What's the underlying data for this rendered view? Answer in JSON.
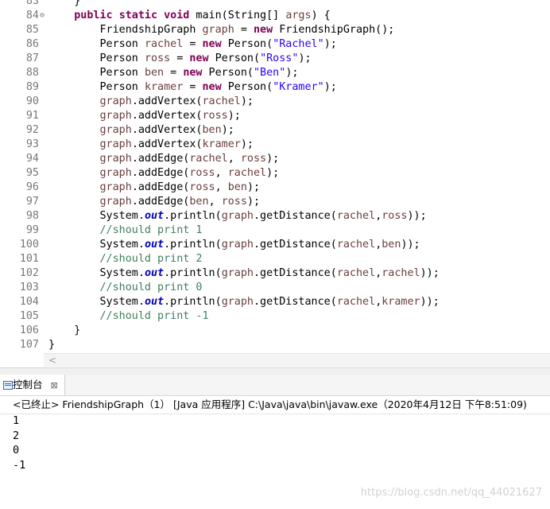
{
  "editor": {
    "lines": [
      {
        "n": "83",
        "fold": "",
        "segs": [
          {
            "t": "    }"
          }
        ]
      },
      {
        "n": "84",
        "fold": "⊖",
        "segs": [
          {
            "t": "    "
          },
          {
            "t": "public",
            "c": "kw"
          },
          {
            "t": " "
          },
          {
            "t": "static",
            "c": "kw"
          },
          {
            "t": " "
          },
          {
            "t": "void",
            "c": "kw"
          },
          {
            "t": " main(String[] "
          },
          {
            "t": "args",
            "c": "local"
          },
          {
            "t": ") {"
          }
        ]
      },
      {
        "n": "85",
        "fold": "",
        "segs": [
          {
            "t": "        FriendshipGraph "
          },
          {
            "t": "graph",
            "c": "local"
          },
          {
            "t": " = "
          },
          {
            "t": "new",
            "c": "kw"
          },
          {
            "t": " FriendshipGraph();"
          }
        ]
      },
      {
        "n": "86",
        "fold": "",
        "segs": [
          {
            "t": "        Person "
          },
          {
            "t": "rachel",
            "c": "local"
          },
          {
            "t": " = "
          },
          {
            "t": "new",
            "c": "kw"
          },
          {
            "t": " Person("
          },
          {
            "t": "\"Rachel\"",
            "c": "str"
          },
          {
            "t": ");"
          }
        ]
      },
      {
        "n": "87",
        "fold": "",
        "segs": [
          {
            "t": "        Person "
          },
          {
            "t": "ross",
            "c": "local"
          },
          {
            "t": " = "
          },
          {
            "t": "new",
            "c": "kw"
          },
          {
            "t": " Person("
          },
          {
            "t": "\"Ross\"",
            "c": "str"
          },
          {
            "t": ");"
          }
        ]
      },
      {
        "n": "88",
        "fold": "",
        "segs": [
          {
            "t": "        Person "
          },
          {
            "t": "ben",
            "c": "local"
          },
          {
            "t": " = "
          },
          {
            "t": "new",
            "c": "kw"
          },
          {
            "t": " Person("
          },
          {
            "t": "\"Ben\"",
            "c": "str"
          },
          {
            "t": ");"
          }
        ]
      },
      {
        "n": "89",
        "fold": "",
        "segs": [
          {
            "t": "        Person "
          },
          {
            "t": "kramer",
            "c": "local"
          },
          {
            "t": " = "
          },
          {
            "t": "new",
            "c": "kw"
          },
          {
            "t": " Person("
          },
          {
            "t": "\"Kramer\"",
            "c": "str"
          },
          {
            "t": ");"
          }
        ]
      },
      {
        "n": "90",
        "fold": "",
        "segs": [
          {
            "t": "        "
          },
          {
            "t": "graph",
            "c": "local"
          },
          {
            "t": ".addVertex("
          },
          {
            "t": "rachel",
            "c": "local"
          },
          {
            "t": ");"
          }
        ]
      },
      {
        "n": "91",
        "fold": "",
        "segs": [
          {
            "t": "        "
          },
          {
            "t": "graph",
            "c": "local"
          },
          {
            "t": ".addVertex("
          },
          {
            "t": "ross",
            "c": "local"
          },
          {
            "t": ");"
          }
        ]
      },
      {
        "n": "92",
        "fold": "",
        "segs": [
          {
            "t": "        "
          },
          {
            "t": "graph",
            "c": "local"
          },
          {
            "t": ".addVertex("
          },
          {
            "t": "ben",
            "c": "local"
          },
          {
            "t": ");"
          }
        ]
      },
      {
        "n": "93",
        "fold": "",
        "segs": [
          {
            "t": "        "
          },
          {
            "t": "graph",
            "c": "local"
          },
          {
            "t": ".addVertex("
          },
          {
            "t": "kramer",
            "c": "local"
          },
          {
            "t": ");"
          }
        ]
      },
      {
        "n": "94",
        "fold": "",
        "segs": [
          {
            "t": "        "
          },
          {
            "t": "graph",
            "c": "local"
          },
          {
            "t": ".addEdge("
          },
          {
            "t": "rachel",
            "c": "local"
          },
          {
            "t": ", "
          },
          {
            "t": "ross",
            "c": "local"
          },
          {
            "t": ");"
          }
        ]
      },
      {
        "n": "95",
        "fold": "",
        "segs": [
          {
            "t": "        "
          },
          {
            "t": "graph",
            "c": "local"
          },
          {
            "t": ".addEdge("
          },
          {
            "t": "ross",
            "c": "local"
          },
          {
            "t": ", "
          },
          {
            "t": "rachel",
            "c": "local"
          },
          {
            "t": ");"
          }
        ]
      },
      {
        "n": "96",
        "fold": "",
        "segs": [
          {
            "t": "        "
          },
          {
            "t": "graph",
            "c": "local"
          },
          {
            "t": ".addEdge("
          },
          {
            "t": "ross",
            "c": "local"
          },
          {
            "t": ", "
          },
          {
            "t": "ben",
            "c": "local"
          },
          {
            "t": ");"
          }
        ]
      },
      {
        "n": "97",
        "fold": "",
        "segs": [
          {
            "t": "        "
          },
          {
            "t": "graph",
            "c": "local"
          },
          {
            "t": ".addEdge("
          },
          {
            "t": "ben",
            "c": "local"
          },
          {
            "t": ", "
          },
          {
            "t": "ross",
            "c": "local"
          },
          {
            "t": ");"
          }
        ]
      },
      {
        "n": "98",
        "fold": "",
        "segs": [
          {
            "t": "        System."
          },
          {
            "t": "out",
            "c": "field"
          },
          {
            "t": ".println("
          },
          {
            "t": "graph",
            "c": "local"
          },
          {
            "t": ".getDistance("
          },
          {
            "t": "rachel",
            "c": "local"
          },
          {
            "t": ","
          },
          {
            "t": "ross",
            "c": "local"
          },
          {
            "t": "));"
          }
        ]
      },
      {
        "n": "99",
        "fold": "",
        "segs": [
          {
            "t": "        "
          },
          {
            "t": "//should print 1",
            "c": "cmt"
          }
        ]
      },
      {
        "n": "100",
        "fold": "",
        "segs": [
          {
            "t": "        System."
          },
          {
            "t": "out",
            "c": "field"
          },
          {
            "t": ".println("
          },
          {
            "t": "graph",
            "c": "local"
          },
          {
            "t": ".getDistance("
          },
          {
            "t": "rachel",
            "c": "local"
          },
          {
            "t": ","
          },
          {
            "t": "ben",
            "c": "local"
          },
          {
            "t": "));"
          }
        ]
      },
      {
        "n": "101",
        "fold": "",
        "segs": [
          {
            "t": "        "
          },
          {
            "t": "//should print 2",
            "c": "cmt"
          }
        ]
      },
      {
        "n": "102",
        "fold": "",
        "segs": [
          {
            "t": "        System."
          },
          {
            "t": "out",
            "c": "field"
          },
          {
            "t": ".println("
          },
          {
            "t": "graph",
            "c": "local"
          },
          {
            "t": ".getDistance("
          },
          {
            "t": "rachel",
            "c": "local"
          },
          {
            "t": ","
          },
          {
            "t": "rachel",
            "c": "local"
          },
          {
            "t": "));"
          }
        ]
      },
      {
        "n": "103",
        "fold": "",
        "segs": [
          {
            "t": "        "
          },
          {
            "t": "//should print 0",
            "c": "cmt"
          }
        ]
      },
      {
        "n": "104",
        "fold": "",
        "segs": [
          {
            "t": "        System."
          },
          {
            "t": "out",
            "c": "field"
          },
          {
            "t": ".println("
          },
          {
            "t": "graph",
            "c": "local"
          },
          {
            "t": ".getDistance("
          },
          {
            "t": "rachel",
            "c": "local"
          },
          {
            "t": ","
          },
          {
            "t": "kramer",
            "c": "local"
          },
          {
            "t": "));"
          }
        ]
      },
      {
        "n": "105",
        "fold": "",
        "segs": [
          {
            "t": "        "
          },
          {
            "t": "//should print -1",
            "c": "cmt"
          }
        ]
      },
      {
        "n": "106",
        "fold": "",
        "segs": [
          {
            "t": "    }"
          }
        ]
      },
      {
        "n": "107",
        "fold": "",
        "segs": [
          {
            "t": "}"
          }
        ]
      }
    ],
    "scroll_arrow": "<"
  },
  "console": {
    "tab_label": "控制台",
    "tab_close": "⊠",
    "description": "<已终止> FriendshipGraph（1） [Java 应用程序] C:\\Java\\java\\bin\\javaw.exe（2020年4月12日 下午8:51:09)",
    "output": [
      "1",
      "2",
      "0",
      "-1"
    ]
  },
  "watermark": "https://blog.csdn.net/qq_44021627"
}
